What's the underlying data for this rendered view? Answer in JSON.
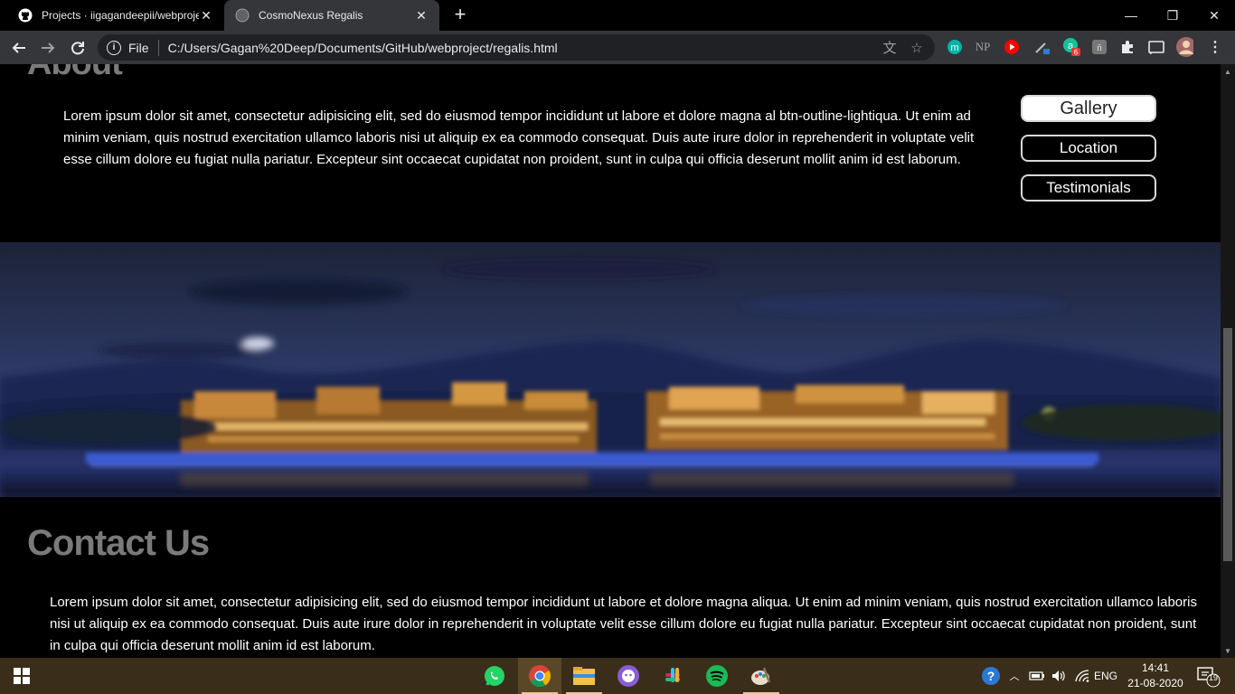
{
  "browser": {
    "tabs": [
      {
        "title": "Projects · iigagandeepii/webproje",
        "active": false
      },
      {
        "title": "CosmoNexus Regalis",
        "active": true
      }
    ],
    "new_tab": "+",
    "omnibox": {
      "security_label": "File",
      "url": "C:/Users/Gagan%20Deep/Documents/GitHub/webproject/regalis.html"
    },
    "extensions": [
      {
        "name": "m-extension-icon",
        "label": "m",
        "color": "#00b3a6"
      },
      {
        "name": "np-extension-icon",
        "label": "NP",
        "color": "#9aa0a6"
      },
      {
        "name": "youtube-extension-icon",
        "label": "▶",
        "color": "#ff0000"
      },
      {
        "name": "pen-extension-icon",
        "label": "✎",
        "color": "#4a90d9"
      },
      {
        "name": "grammarly-extension-icon",
        "label": "a",
        "badge": "6",
        "color": "#15c39a"
      },
      {
        "name": "reader-extension-icon",
        "label": "ñ",
        "color": "#888888"
      }
    ]
  },
  "page": {
    "about_heading": "About",
    "about_text": "Lorem ipsum dolor sit amet, consectetur adipisicing elit, sed do eiusmod tempor incididunt ut labore et dolore magna al btn-outline-lightiqua. Ut enim ad minim veniam, quis nostrud exercitation ullamco laboris nisi ut aliquip ex ea commodo consequat. Duis aute irure dolor in reprehenderit in voluptate velit esse cillum dolore eu fugiat nulla pariatur. Excepteur sint occaecat cupidatat non proident, sunt in culpa qui officia deserunt mollit anim id est laborum.",
    "buttons": {
      "gallery": "Gallery",
      "location": "Location",
      "testimonials": "Testimonials"
    },
    "contact_heading": "Contact Us",
    "contact_text": "Lorem ipsum dolor sit amet, consectetur adipisicing elit, sed do eiusmod tempor incididunt ut labore et dolore magna aliqua. Ut enim ad minim veniam, quis nostrud exercitation ullamco laboris nisi ut aliquip ex ea commodo consequat. Duis aute irure dolor in reprehenderit in voluptate velit esse cillum dolore eu fugiat nulla pariatur. Excepteur sint occaecat cupidatat non proident, sunt in culpa qui officia deserunt mollit anim id est laborum."
  },
  "taskbar": {
    "apps": [
      "whatsapp-icon",
      "chrome-icon",
      "file-explorer-icon",
      "github-desktop-icon",
      "slack-icon",
      "spotify-icon",
      "paint-icon"
    ],
    "tray": {
      "language": "ENG",
      "time": "14:41",
      "date": "21-08-2020",
      "notification_count": "19"
    }
  },
  "colors": {
    "page_bg": "#000000",
    "heading_gray": "#7a7a7a",
    "chrome_toolbar": "#35363a",
    "taskbar": "#3a2e1a"
  }
}
